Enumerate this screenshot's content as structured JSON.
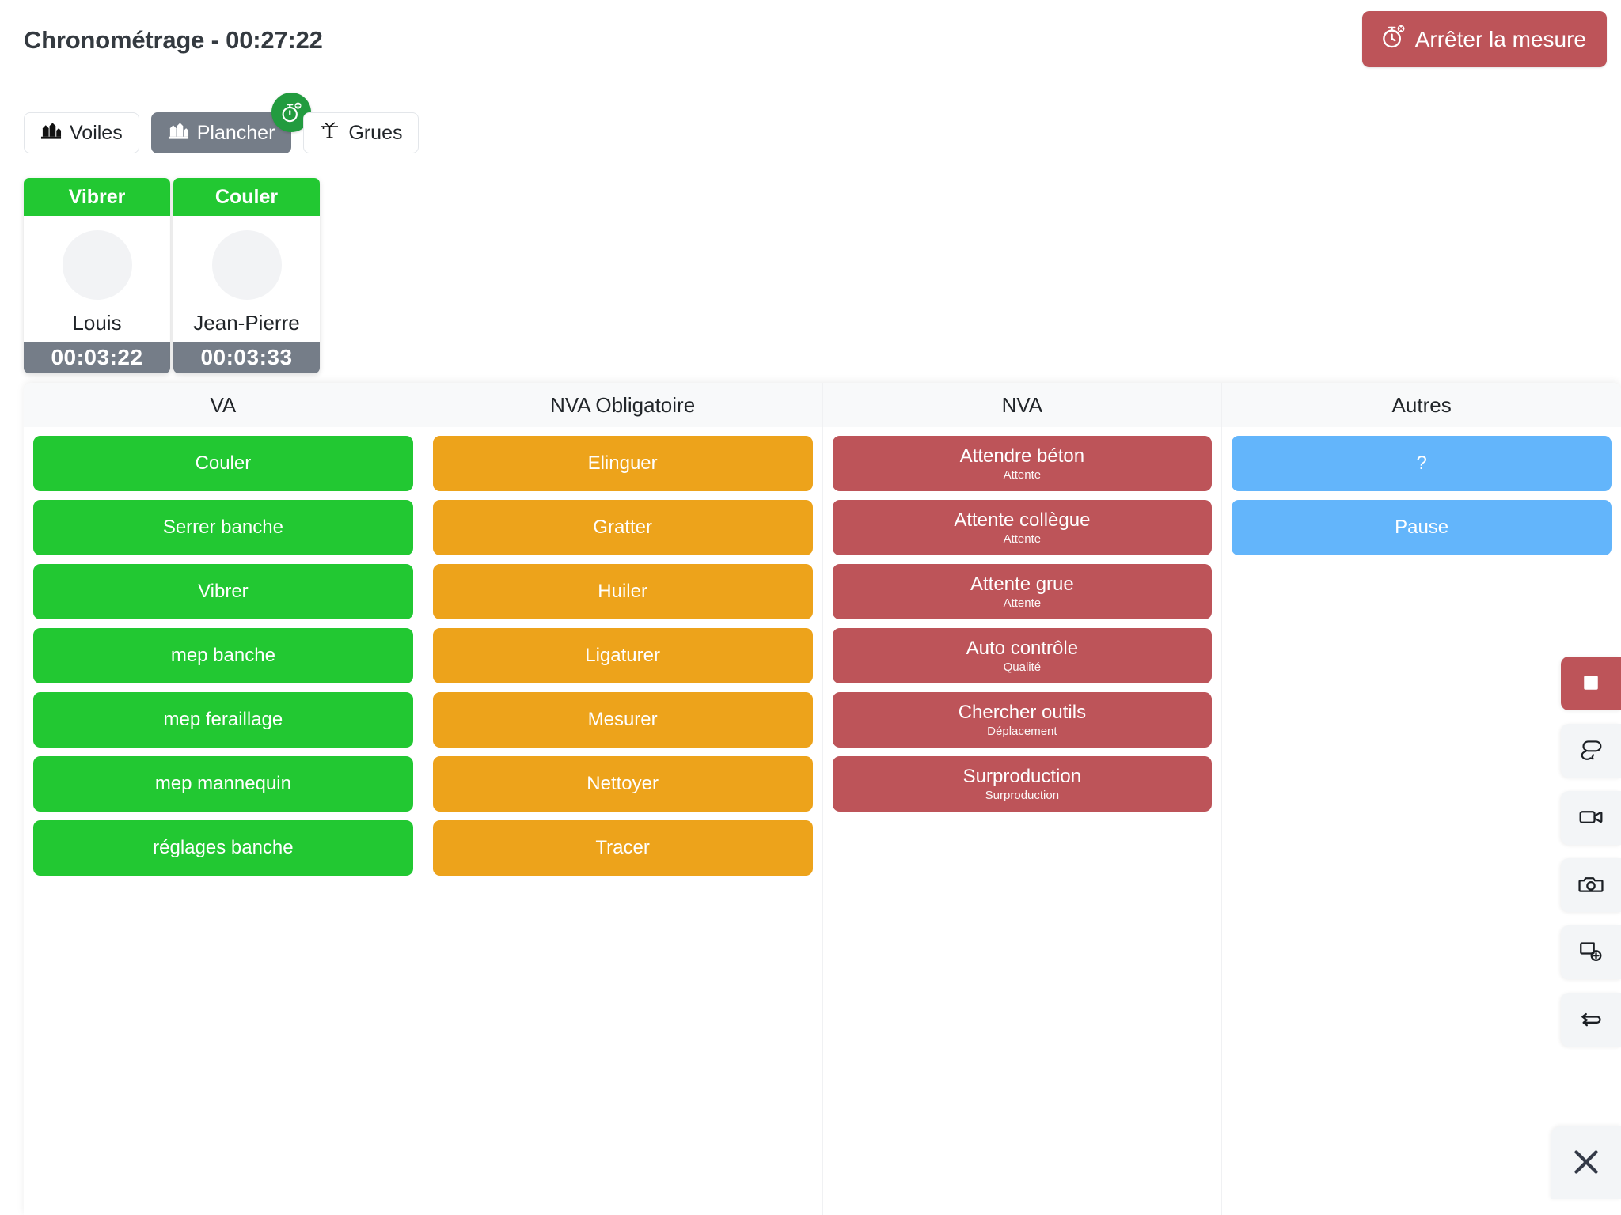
{
  "header": {
    "title": "Chronométrage - 00:27:22",
    "stop_button_label": "Arrêter la mesure",
    "stop_button_icon": "stopwatch-stop-icon",
    "stop_button_color": "#bd5459"
  },
  "tabs": [
    {
      "label": "Voiles",
      "icon": "wall-panels-icon",
      "active": false,
      "badge": null
    },
    {
      "label": "Plancher",
      "icon": "wall-panels-icon",
      "active": true,
      "badge": {
        "icon": "stopwatch-plus-icon",
        "color": "#229b3f"
      }
    },
    {
      "label": "Grues",
      "icon": "crane-icon",
      "active": false,
      "badge": null
    }
  ],
  "workers": [
    {
      "task": "Vibrer",
      "task_color": "#22c832",
      "name": "Louis",
      "elapsed": "00:03:22",
      "avatar": "avatar-placeholder"
    },
    {
      "task": "Couler",
      "task_color": "#22c832",
      "name": "Jean-Pierre",
      "elapsed": "00:03:33",
      "avatar": "avatar-placeholder"
    }
  ],
  "board": {
    "columns": [
      {
        "title": "VA",
        "color": "#22c832",
        "variant": "va",
        "tasks": [
          {
            "label": "Couler",
            "sub": ""
          },
          {
            "label": "Serrer banche",
            "sub": ""
          },
          {
            "label": "Vibrer",
            "sub": ""
          },
          {
            "label": "mep banche",
            "sub": ""
          },
          {
            "label": "mep feraillage",
            "sub": ""
          },
          {
            "label": "mep mannequin",
            "sub": ""
          },
          {
            "label": "réglages banche",
            "sub": ""
          }
        ]
      },
      {
        "title": "NVA Obligatoire",
        "color": "#eda31b",
        "variant": "nvao",
        "tasks": [
          {
            "label": "Elinguer",
            "sub": ""
          },
          {
            "label": "Gratter",
            "sub": ""
          },
          {
            "label": "Huiler",
            "sub": ""
          },
          {
            "label": "Ligaturer",
            "sub": ""
          },
          {
            "label": "Mesurer",
            "sub": ""
          },
          {
            "label": "Nettoyer",
            "sub": ""
          },
          {
            "label": "Tracer",
            "sub": ""
          }
        ]
      },
      {
        "title": "NVA",
        "color": "#bd5459",
        "variant": "nva",
        "tasks": [
          {
            "label": "Attendre béton",
            "sub": "Attente"
          },
          {
            "label": "Attente collègue",
            "sub": "Attente"
          },
          {
            "label": "Attente grue",
            "sub": "Attente"
          },
          {
            "label": "Auto contrôle",
            "sub": "Qualité"
          },
          {
            "label": "Chercher outils",
            "sub": "Déplacement"
          },
          {
            "label": "Surproduction",
            "sub": "Surproduction"
          }
        ]
      },
      {
        "title": "Autres",
        "color": "#63b5fb",
        "variant": "autre",
        "tasks": [
          {
            "label": "?",
            "sub": ""
          },
          {
            "label": "Pause",
            "sub": ""
          }
        ]
      }
    ]
  },
  "toolbar": {
    "buttons": [
      {
        "icon": "stop-square-icon",
        "variant": "stop"
      },
      {
        "icon": "chat-bubbles-icon",
        "variant": "plain"
      },
      {
        "icon": "video-camera-icon",
        "variant": "plain"
      },
      {
        "icon": "photo-camera-icon",
        "variant": "plain"
      },
      {
        "icon": "add-note-icon",
        "variant": "plain"
      },
      {
        "icon": "swap-repeat-icon",
        "variant": "plain"
      }
    ],
    "close_icon": "close-icon"
  }
}
